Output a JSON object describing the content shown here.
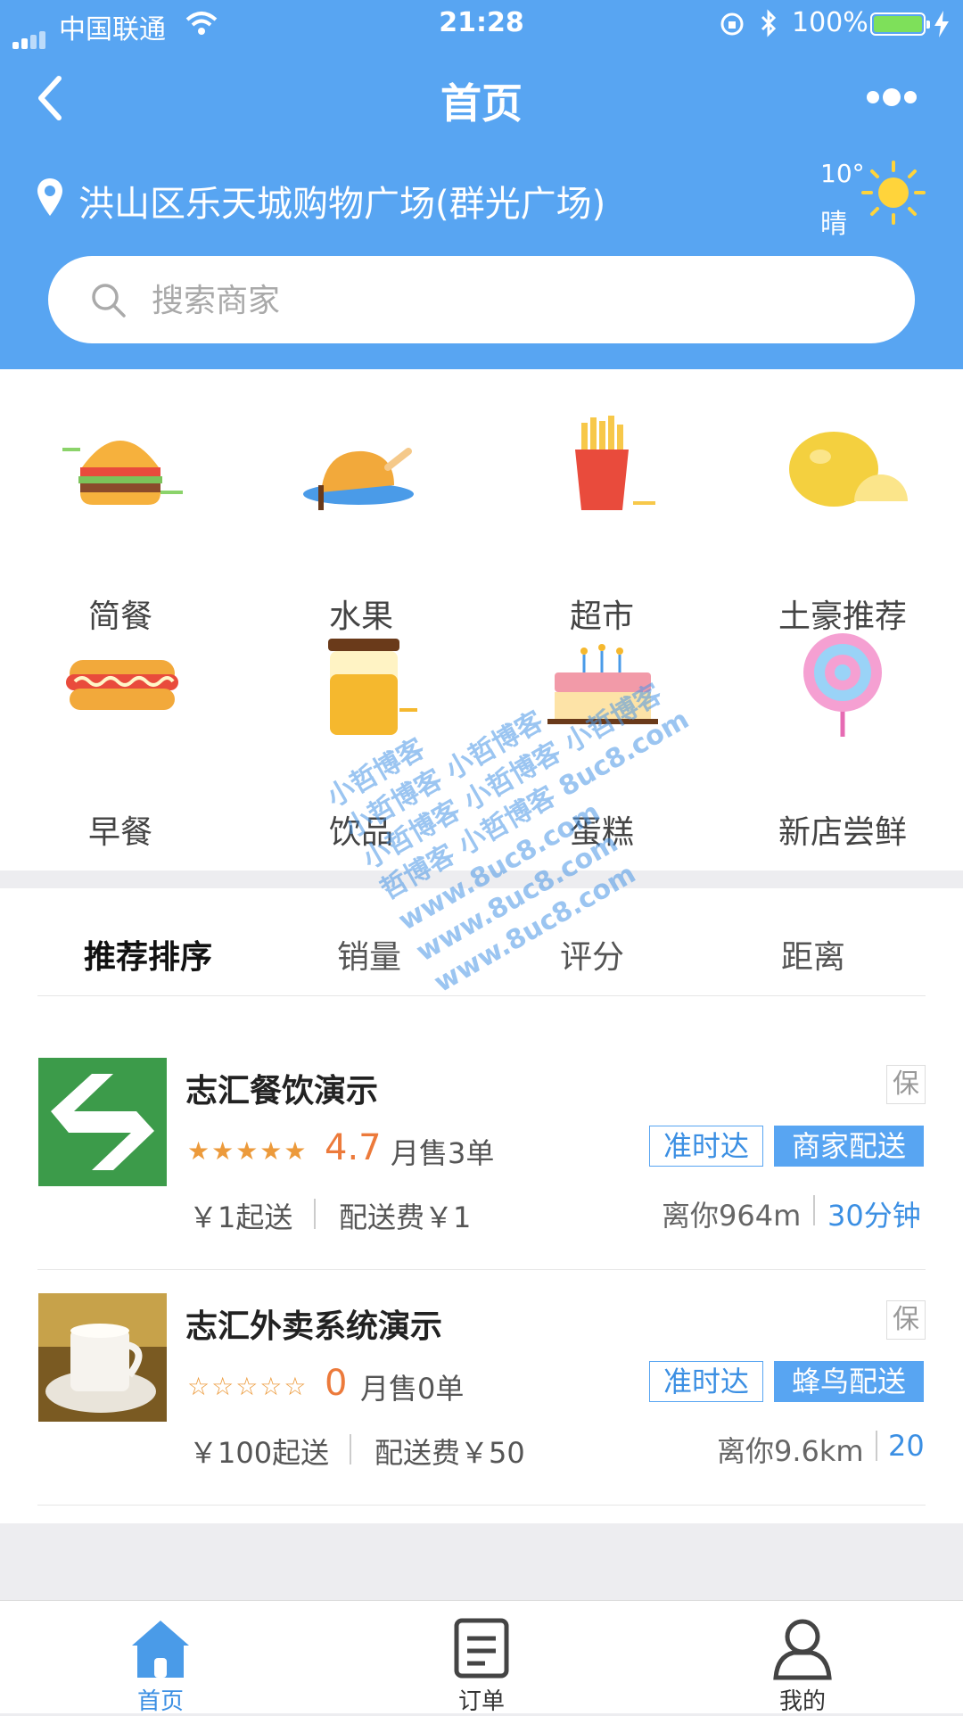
{
  "status_bar": {
    "carrier": "中国联通",
    "time": "21:28",
    "battery": "100%"
  },
  "nav": {
    "title": "首页"
  },
  "location": {
    "address": "洪山区乐天城购物广场(群光广场)"
  },
  "weather": {
    "temp": "10°",
    "desc": "晴"
  },
  "search": {
    "placeholder": "搜索商家"
  },
  "categories": [
    {
      "label": "简餐",
      "icon": "burger-icon"
    },
    {
      "label": "水果",
      "icon": "roast-chicken-icon"
    },
    {
      "label": "超市",
      "icon": "fries-icon"
    },
    {
      "label": "土豪推荐",
      "icon": "lemon-icon"
    },
    {
      "label": "早餐",
      "icon": "hotdog-icon"
    },
    {
      "label": "饮品",
      "icon": "juice-jar-icon"
    },
    {
      "label": "蛋糕",
      "icon": "cake-icon"
    },
    {
      "label": "新店尝鲜",
      "icon": "lollipop-icon"
    }
  ],
  "sort_tabs": [
    "推荐排序",
    "销量",
    "评分",
    "距离"
  ],
  "shops": [
    {
      "name": "志汇餐饮演示",
      "badge": "保",
      "rating": "4.7",
      "stars": "★★★★★",
      "monthly_sales": "月售3单",
      "tag_on_time": "准时达",
      "tag_delivery": "商家配送",
      "min_order": "￥1起送",
      "delivery_fee": "配送费￥1",
      "distance": "离你964m",
      "eta": "30分钟"
    },
    {
      "name": "志汇外卖系统演示",
      "badge": "保",
      "rating": "0",
      "stars": "☆☆☆☆☆",
      "monthly_sales": "月售0单",
      "tag_on_time": "准时达",
      "tag_delivery": "蜂鸟配送",
      "min_order": "￥100起送",
      "delivery_fee": "配送费￥50",
      "distance": "离你9.6km",
      "eta": "20"
    }
  ],
  "watermark": [
    "小哲博客",
    "小哲博客 小哲博客",
    "小哲博客 小哲博客 小哲博客",
    "哲博客 小哲博客 8uc8.com",
    "www.8uc8.com",
    "www.8uc8.com",
    "www.8uc8.com"
  ],
  "tabbar": {
    "home": "首页",
    "orders": "订单",
    "mine": "我的"
  },
  "colors": {
    "primary": "#58a5f2",
    "rating": "#ec7a3b",
    "link": "#3b8fe3"
  }
}
